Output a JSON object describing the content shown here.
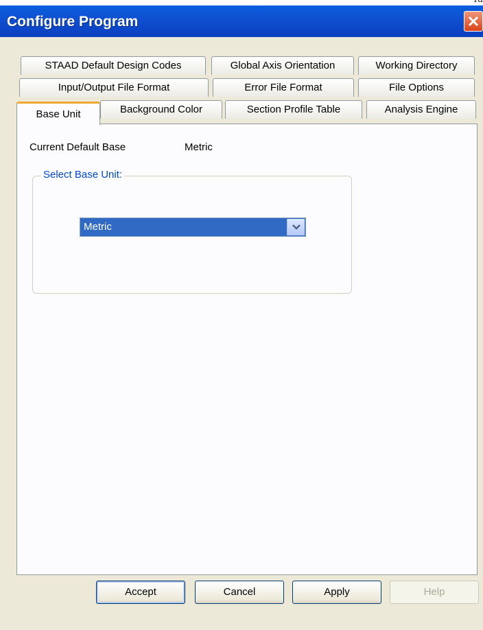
{
  "corner_text": "Ta",
  "dialog": {
    "title": "Configure Program"
  },
  "tabs": {
    "row1": [
      "STAAD Default Design Codes",
      "Global Axis Orientation",
      "Working Directory"
    ],
    "row2": [
      "Input/Output File Format",
      "Error File Format",
      "File Options"
    ],
    "row3": [
      "Base Unit",
      "Background Color",
      "Section Profile Table",
      "Analysis Engine"
    ],
    "active": "Base Unit"
  },
  "content": {
    "current_label": "Current Default Base",
    "current_value": "Metric",
    "group_title": "Select Base Unit:",
    "select_value": "Metric"
  },
  "buttons": {
    "accept": "Accept",
    "cancel": "Cancel",
    "apply": "Apply",
    "help": "Help"
  },
  "colors": {
    "titlebar": "#0b4fd1",
    "accent_tab": "#f0a830",
    "selection": "#316ac5"
  }
}
